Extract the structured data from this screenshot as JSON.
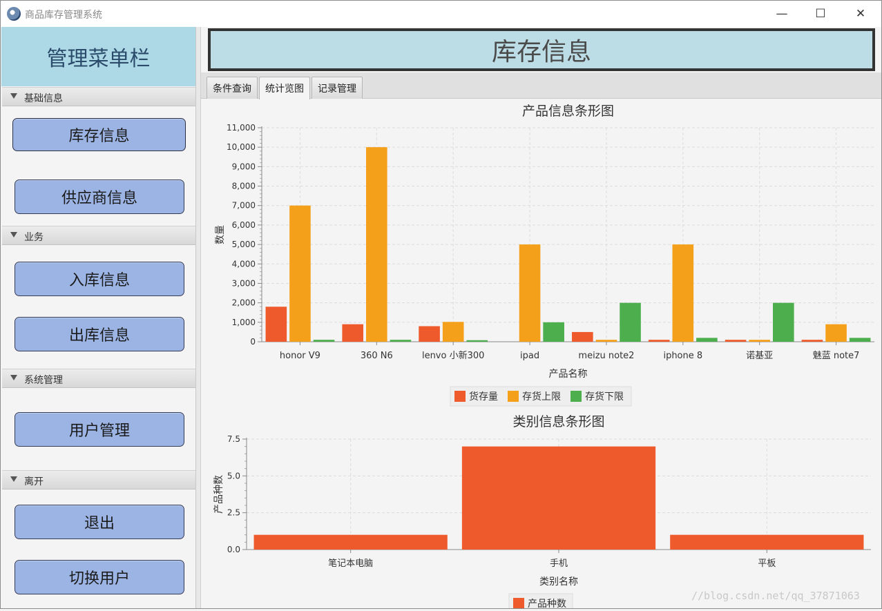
{
  "window": {
    "title": "商品库存管理系统",
    "min_glyph": "—",
    "max_glyph": "☐",
    "close_glyph": "✕"
  },
  "sidebar": {
    "header": "管理菜单栏",
    "sections": [
      {
        "label": "基础信息",
        "buttons": [
          "库存信息",
          "供应商信息"
        ]
      },
      {
        "label": "业务",
        "buttons": [
          "入库信息",
          "出库信息"
        ]
      },
      {
        "label": "系统管理",
        "buttons": [
          "用户管理"
        ]
      },
      {
        "label": "离开",
        "buttons": [
          "退出",
          "切换用户"
        ]
      }
    ]
  },
  "main": {
    "banner": "库存信息",
    "tabs": [
      "条件查询",
      "统计览图",
      "记录管理"
    ],
    "active_tab": 1
  },
  "watermark": "//blog.csdn.net/qq_37871063",
  "colors": {
    "series1": "#ee5a2b",
    "series2": "#f5a01a",
    "series3": "#4cae4c",
    "accent": "#add8e6"
  },
  "chart_data": [
    {
      "type": "bar",
      "title": "产品信息条形图",
      "xlabel": "产品名称",
      "ylabel": "数量",
      "categories": [
        "honor V9",
        "360 N6",
        "lenvo 小新300",
        "ipad",
        "meizu note2",
        "iphone 8",
        "诺基亚",
        "魅蓝 note7"
      ],
      "ylim": [
        0,
        11000
      ],
      "yticks": [
        "0",
        "1,000",
        "2,000",
        "3,000",
        "4,000",
        "5,000",
        "6,000",
        "7,000",
        "8,000",
        "9,000",
        "10,000",
        "11,000"
      ],
      "grid": true,
      "legend": "bottom",
      "series": [
        {
          "name": "货存量",
          "values": [
            1800,
            900,
            800,
            0,
            500,
            100,
            100,
            100
          ]
        },
        {
          "name": "存货上限",
          "values": [
            7000,
            10000,
            1020,
            5000,
            100,
            5000,
            100,
            900
          ]
        },
        {
          "name": "存货下限",
          "values": [
            100,
            100,
            80,
            1000,
            2000,
            200,
            2000,
            200
          ]
        }
      ]
    },
    {
      "type": "bar",
      "title": "类别信息条形图",
      "xlabel": "类别名称",
      "ylabel": "产品种数",
      "categories": [
        "笔记本电脑",
        "手机",
        "平板"
      ],
      "ylim": [
        0,
        7.5
      ],
      "yticks": [
        "0.0",
        "2.5",
        "5.0",
        "7.5"
      ],
      "grid": true,
      "legend": "bottom",
      "series": [
        {
          "name": "产品种数",
          "values": [
            1,
            7,
            1
          ]
        }
      ]
    }
  ]
}
